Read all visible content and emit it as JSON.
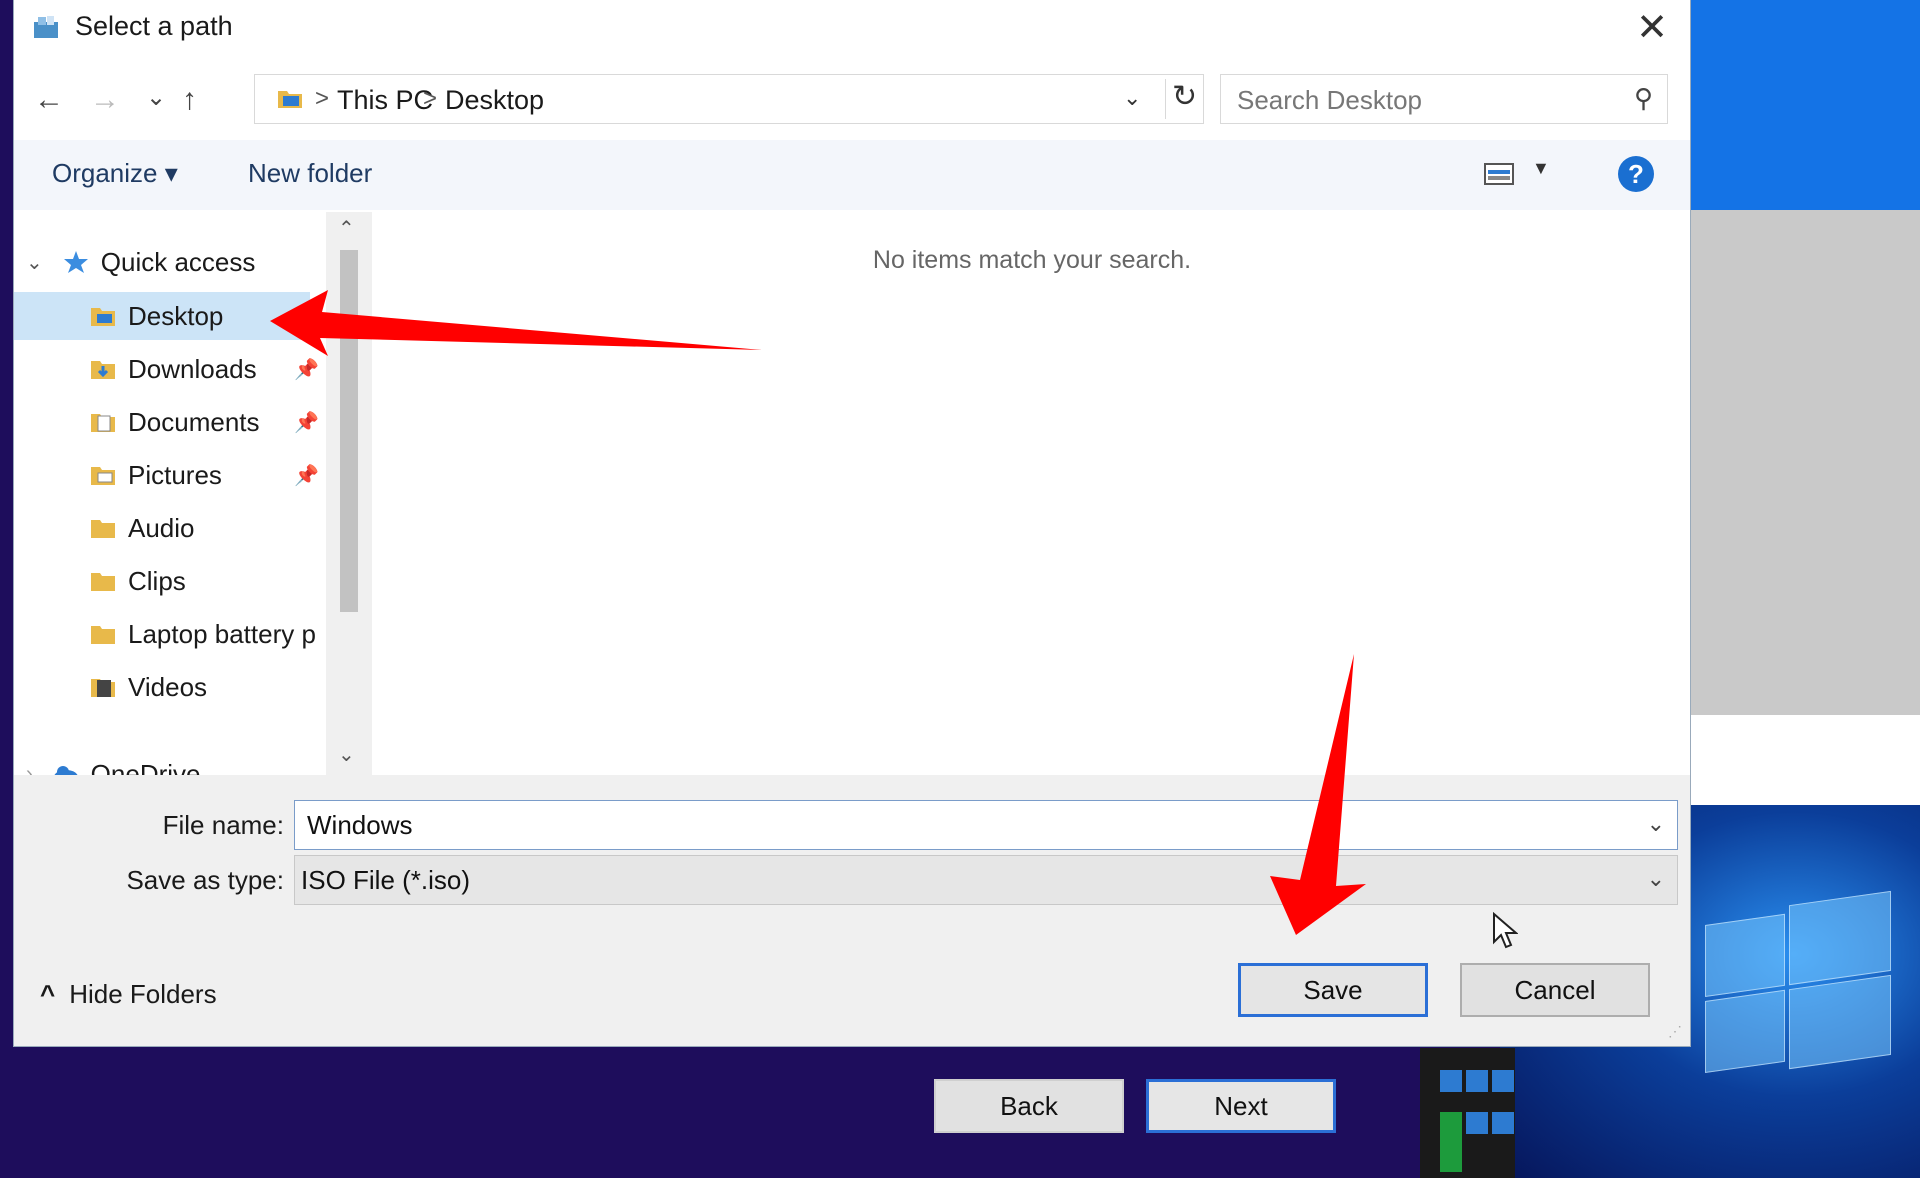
{
  "dialog": {
    "title": "Select a path",
    "close_glyph": "✕",
    "nav": {
      "back": "←",
      "forward": "→",
      "recent": "⌄",
      "up": "↑"
    },
    "breadcrumb": [
      "This PC",
      "Desktop"
    ],
    "breadcrumb_sep": ">",
    "address_dropdown": "⌄",
    "refresh_glyph": "↻",
    "search_placeholder": "Search Desktop",
    "search_glyph": "⚲",
    "toolbar": {
      "organize": "Organize ▾",
      "new_folder": "New folder",
      "help": "?"
    },
    "tree": {
      "quick_access": "Quick access",
      "items": [
        {
          "label": "Desktop",
          "icon": "desktop-folder-icon",
          "pinned": false,
          "selected": true
        },
        {
          "label": "Downloads",
          "icon": "downloads-folder-icon",
          "pinned": true
        },
        {
          "label": "Documents",
          "icon": "documents-folder-icon",
          "pinned": true
        },
        {
          "label": "Pictures",
          "icon": "pictures-folder-icon",
          "pinned": true
        },
        {
          "label": "Audio",
          "icon": "folder-icon",
          "pinned": false
        },
        {
          "label": "Clips",
          "icon": "folder-icon",
          "pinned": false
        },
        {
          "label": "Laptop battery p",
          "icon": "folder-icon",
          "pinned": false
        },
        {
          "label": "Videos",
          "icon": "videos-folder-icon",
          "pinned": false
        }
      ],
      "onedrive": "OneDrive"
    },
    "empty_message": "No items match your search.",
    "file_name_label": "File name:",
    "file_name_value": "Windows",
    "save_type_label": "Save as type:",
    "save_type_value": "ISO File (*.iso)",
    "hide_folders": "Hide Folders",
    "save_button": "Save",
    "cancel_button": "Cancel"
  },
  "setup": {
    "back": "Back",
    "next": "Next"
  },
  "colors": {
    "accent": "#2b6fd6",
    "selection": "#cce4f7",
    "annotation_arrow": "#ff0000",
    "setup_background": "#1e0d5c"
  }
}
